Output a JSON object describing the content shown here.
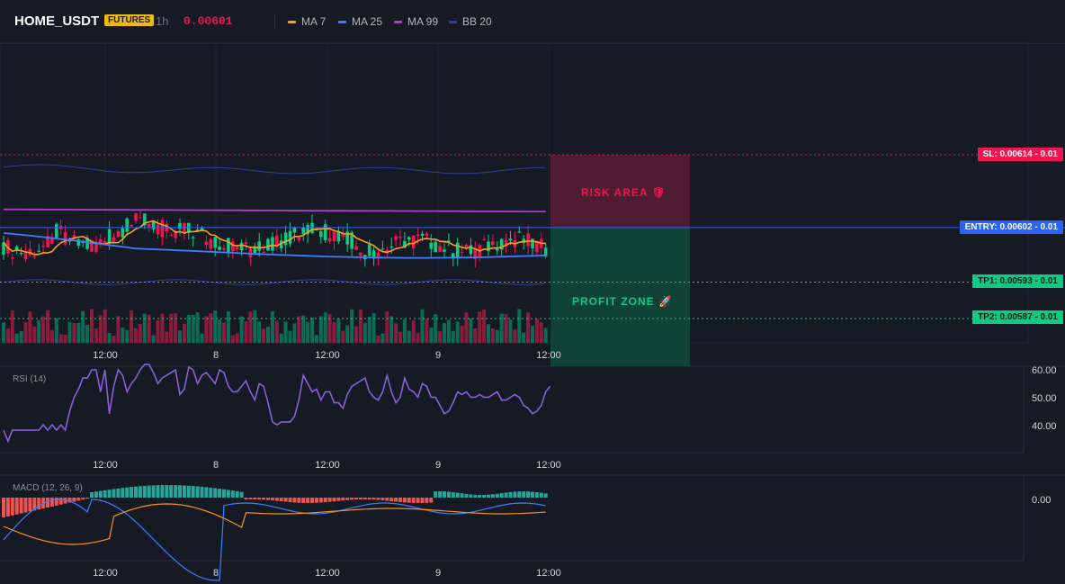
{
  "header": {
    "symbol": "HOME_USDT",
    "badge": "FUTURES",
    "timeframe": "1h",
    "price": "0.00601",
    "indicators": [
      {
        "label": "MA 7",
        "color": "#f7a21b"
      },
      {
        "label": "MA 25",
        "color": "#3d7eff"
      },
      {
        "label": "MA 99",
        "color": "#b23cc9"
      },
      {
        "label": "BB 20",
        "color": "#2a3f9e"
      }
    ]
  },
  "zones": {
    "risk_label": "RISK AREA 🛡",
    "profit_label": "PROFIT ZONE 🚀"
  },
  "price_levels": {
    "sl": "SL: 0.00614 - 0.01",
    "entry": "ENTRY: 0.00602 - 0.01",
    "tp1": "TP1: 0.00593 - 0.01",
    "tp2": "TP2: 0.00587 - 0.01"
  },
  "colors": {
    "bull": "#0ecb81",
    "bear": "#f0144f",
    "sl": "#f0144f",
    "entry": "#2962ff",
    "tp": "#0ecb81",
    "rsi": "#8a5fd6",
    "macd": "#3d7eff",
    "signal": "#f7931a"
  },
  "x_ticks": [
    "12:00",
    "8",
    "12:00",
    "9",
    "12:00"
  ],
  "rsi": {
    "label": "RSI (14)",
    "ticks": [
      "60.00",
      "50.00",
      "40.00"
    ],
    "values": [
      38,
      34,
      38,
      38,
      38,
      38,
      38,
      38,
      38,
      40,
      38,
      40,
      38,
      40,
      38,
      45,
      50,
      53,
      57,
      57,
      60,
      60,
      52,
      60,
      44,
      54,
      60,
      58,
      52,
      55,
      57,
      60,
      62,
      62,
      59,
      55,
      57,
      58,
      59,
      60,
      51,
      53,
      61,
      60,
      55,
      58,
      59,
      57,
      55,
      60,
      59,
      54,
      52,
      52,
      54,
      56,
      52,
      49,
      55,
      54,
      48,
      41,
      40,
      41,
      41,
      41,
      43,
      49,
      58,
      55,
      52,
      53,
      49,
      52,
      52,
      48,
      48,
      46,
      51,
      54,
      55,
      56,
      57,
      52,
      50,
      49,
      52,
      58,
      52,
      48,
      50,
      57,
      53,
      52,
      50,
      55,
      54,
      50,
      50,
      47,
      44,
      45,
      48,
      52,
      51,
      52,
      50,
      50,
      51,
      50,
      50,
      51,
      52,
      49,
      49,
      50,
      51,
      50,
      47,
      46,
      44,
      45,
      47,
      52,
      54
    ]
  },
  "macd": {
    "label": "MACD (12, 26, 9)",
    "ticks": [
      "0.00"
    ]
  }
}
